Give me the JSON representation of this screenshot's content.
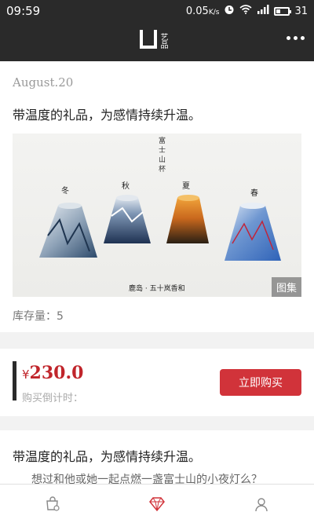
{
  "status_bar": {
    "time": "09:59",
    "net_speed": "0.05",
    "net_unit": "K/s",
    "battery": "31",
    "battery_level": 0.31
  },
  "app": {
    "logo_text": "艺品"
  },
  "article": {
    "date": "August.20",
    "title": "带温度的礼品，为感情持续升温。",
    "photo": {
      "top_text": "富士山杯",
      "season_labels": [
        "冬",
        "秋",
        "夏",
        "春"
      ],
      "caption": "鹿岛 · 五十岚香和",
      "gallery_label": "图集"
    },
    "stock_label": "库存量：",
    "stock_value": "5"
  },
  "purchase": {
    "currency": "¥",
    "price": "230.0",
    "countdown_label": "购买倒计时：",
    "buy_label": "立即购买"
  },
  "details": {
    "title": "带温度的礼品，为感情持续升温。",
    "subtitle": "想过和他或她一起点燃一盏富士山的小夜灯么？"
  },
  "colors": {
    "header": "#2a2a2a",
    "accent": "#d1333a",
    "price": "#c0252b"
  },
  "tabs": [
    {
      "icon": "cart-icon"
    },
    {
      "icon": "diamond-icon",
      "active": true
    },
    {
      "icon": "user-icon"
    }
  ]
}
